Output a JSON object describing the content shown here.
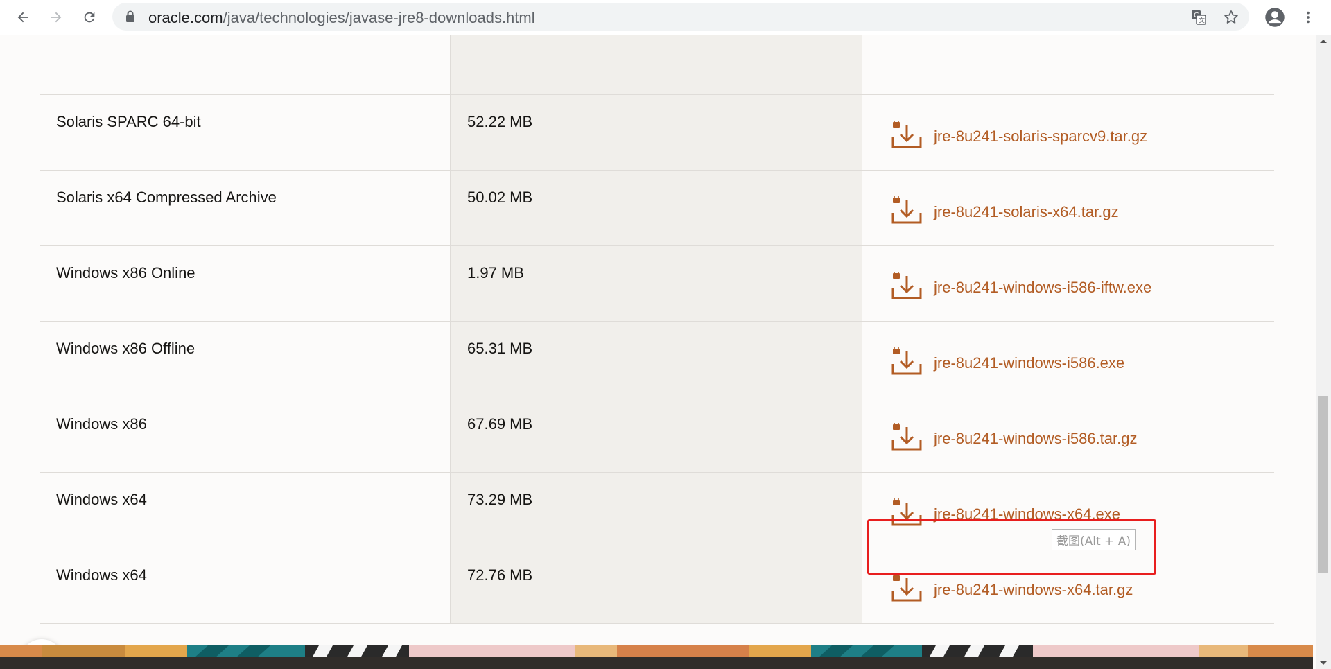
{
  "browser": {
    "url_host": "oracle.com",
    "url_path": "/java/technologies/javase-jre8-downloads.html"
  },
  "table": {
    "rows": [
      {
        "name": "",
        "size": "",
        "file": ""
      },
      {
        "name": "Solaris SPARC 64-bit",
        "size": "52.22 MB",
        "file": "jre-8u241-solaris-sparcv9.tar.gz"
      },
      {
        "name": "Solaris x64 Compressed Archive",
        "size": "50.02 MB",
        "file": "jre-8u241-solaris-x64.tar.gz"
      },
      {
        "name": "Windows x86 Online",
        "size": "1.97 MB",
        "file": "jre-8u241-windows-i586-iftw.exe"
      },
      {
        "name": "Windows x86 Offline",
        "size": "65.31 MB",
        "file": "jre-8u241-windows-i586.exe"
      },
      {
        "name": "Windows x86",
        "size": "67.69 MB",
        "file": "jre-8u241-windows-i586.tar.gz"
      },
      {
        "name": "Windows x64",
        "size": "73.29 MB",
        "file": "jre-8u241-windows-x64.exe"
      },
      {
        "name": "Windows x64",
        "size": "72.76 MB",
        "file": "jre-8u241-windows-x64.tar.gz"
      }
    ]
  },
  "overlay": {
    "tooltip": "截图(Alt + A)"
  },
  "colors": {
    "link": "#b25c24",
    "highlight": "#e81e1e"
  }
}
